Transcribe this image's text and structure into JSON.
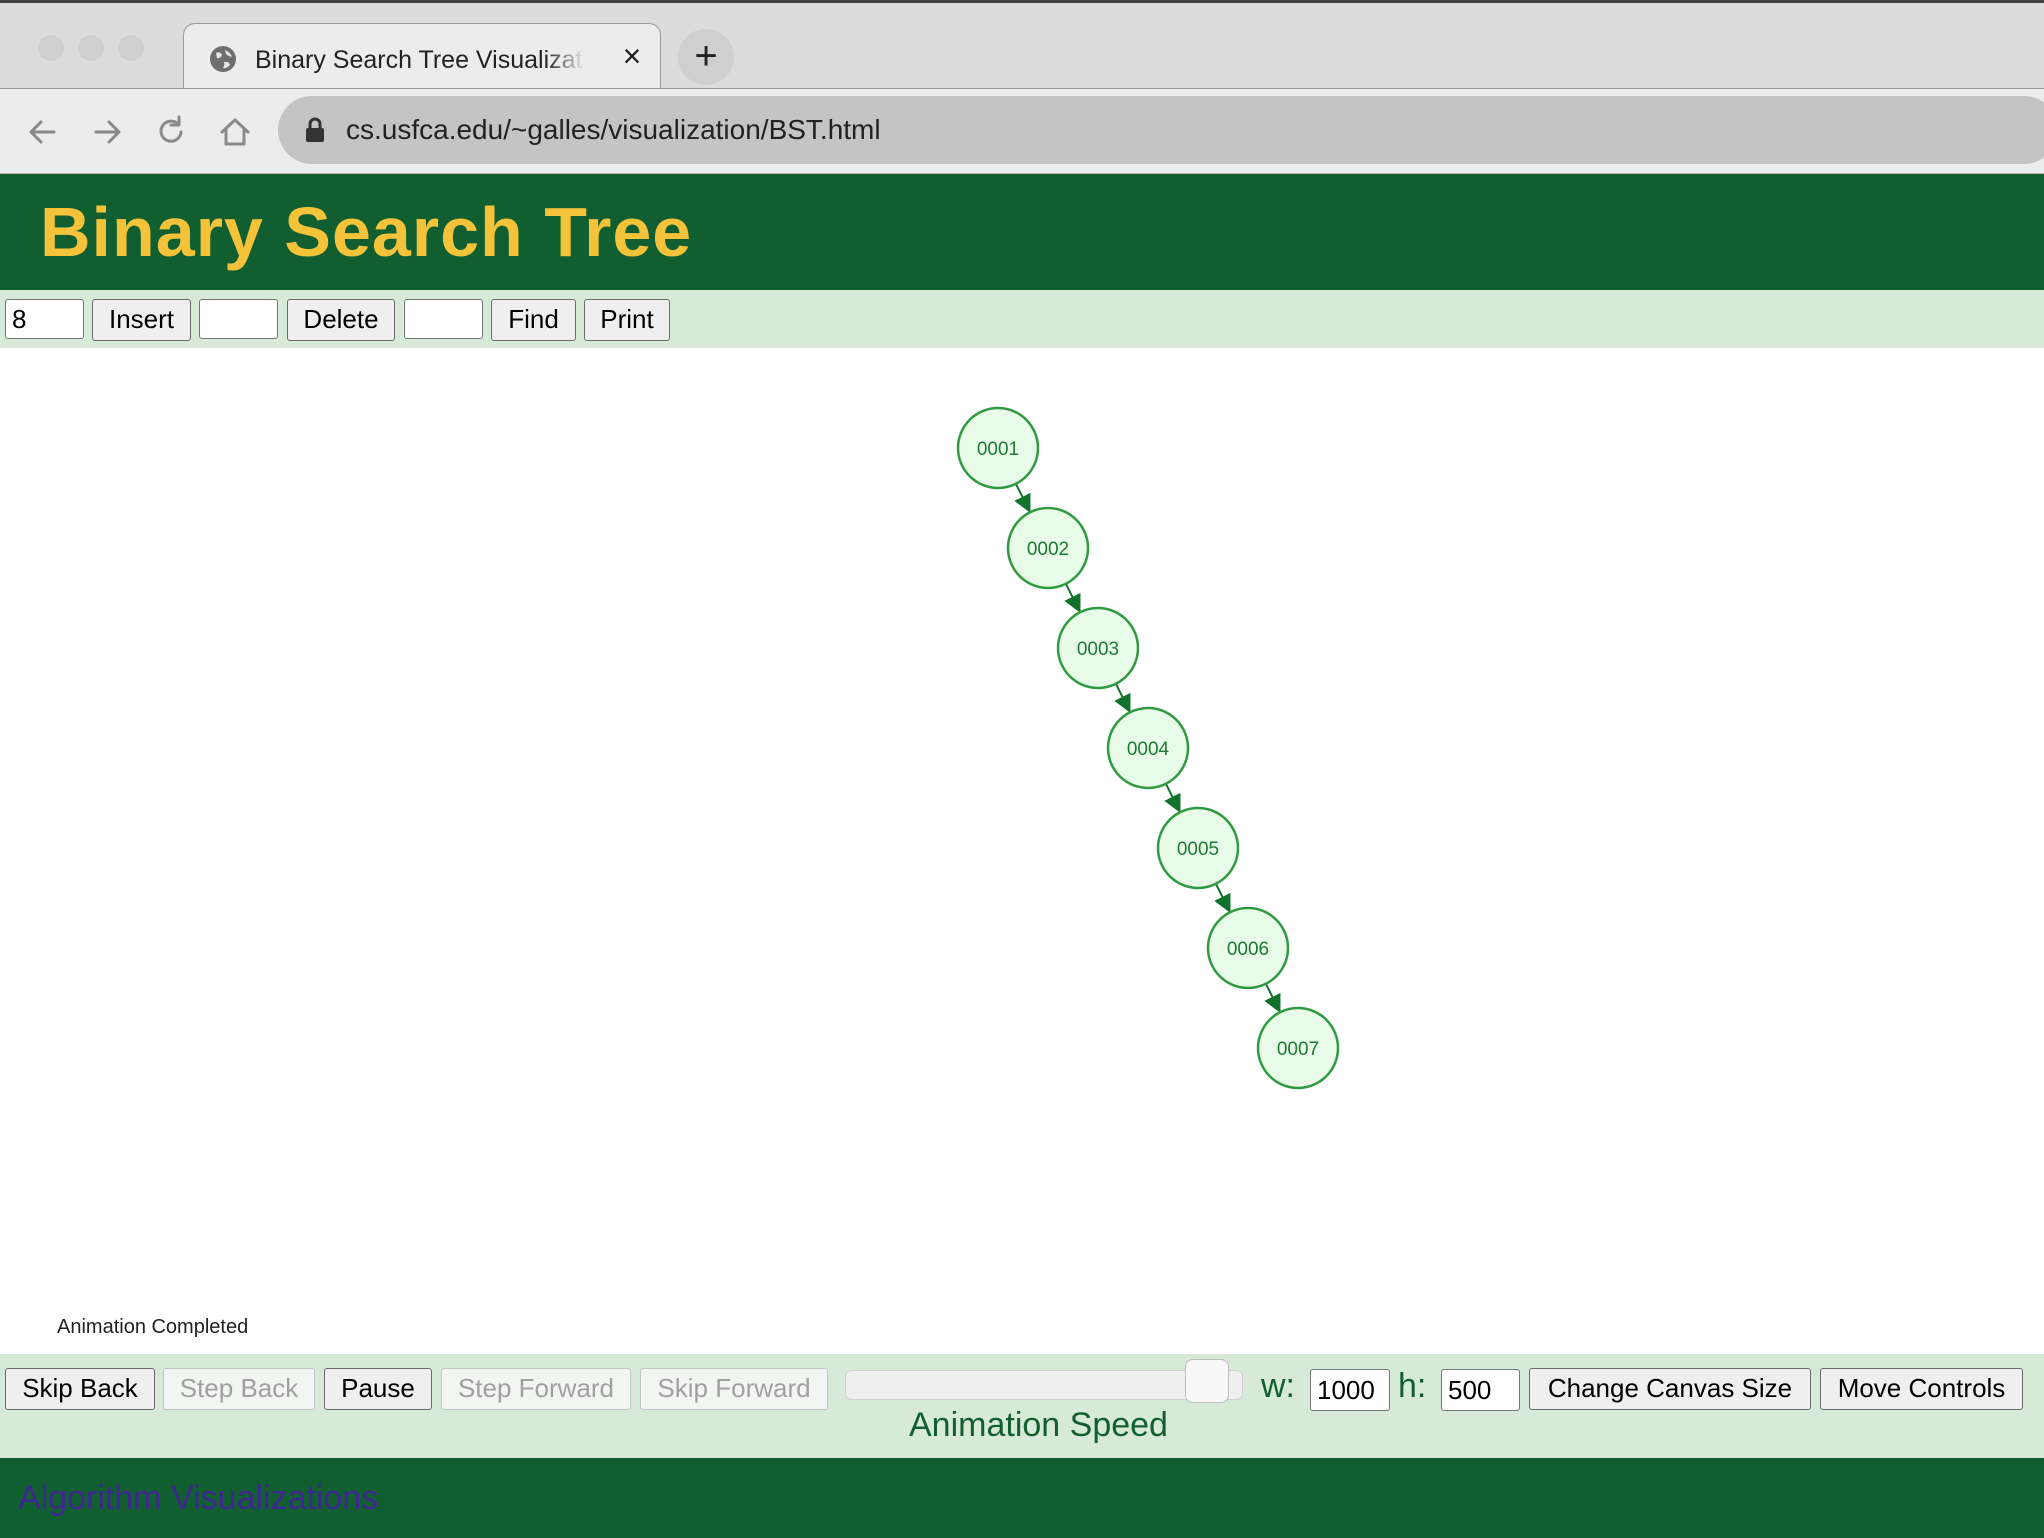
{
  "browser": {
    "tab_title": "Binary Search Tree Visualization",
    "new_tab_icon": "plus-icon",
    "url": "cs.usfca.edu/~galles/visualization/BST.html"
  },
  "page": {
    "title": "Binary Search Tree"
  },
  "algorithm_controls": {
    "insert_value": "8",
    "insert_label": "Insert",
    "delete_value": "",
    "delete_label": "Delete",
    "find_value": "",
    "find_label": "Find",
    "print_label": "Print"
  },
  "tree": {
    "node_fill": "#e8fbe8",
    "node_stroke": "#2f9a3f",
    "edge_color": "#11722b",
    "nodes": [
      {
        "label": "0001",
        "parent": null,
        "side": null
      },
      {
        "label": "0002",
        "parent": 0,
        "side": "right"
      },
      {
        "label": "0003",
        "parent": 1,
        "side": "right"
      },
      {
        "label": "0004",
        "parent": 2,
        "side": "right"
      },
      {
        "label": "0005",
        "parent": 3,
        "side": "right"
      },
      {
        "label": "0006",
        "parent": 4,
        "side": "right"
      },
      {
        "label": "0007",
        "parent": 5,
        "side": "right"
      }
    ]
  },
  "status": {
    "text": "Animation Completed"
  },
  "animation_controls": {
    "skip_back": "Skip Back",
    "step_back": "Step Back",
    "pause": "Pause",
    "step_forward": "Step Forward",
    "skip_forward": "Skip Forward",
    "speed_label": "Animation Speed",
    "speed_fraction": 0.96,
    "w_label": "w:",
    "w_value": "1000",
    "h_label": "h:",
    "h_value": "500",
    "change_canvas_size": "Change Canvas Size",
    "move_controls": "Move Controls"
  },
  "footer": {
    "link_text": "Algorithm Visualizations"
  },
  "colors": {
    "header_bg": "#115f31",
    "title_color": "#f5c33a",
    "control_bar_bg": "#d7ead8",
    "footer_link": "#3f2690"
  }
}
